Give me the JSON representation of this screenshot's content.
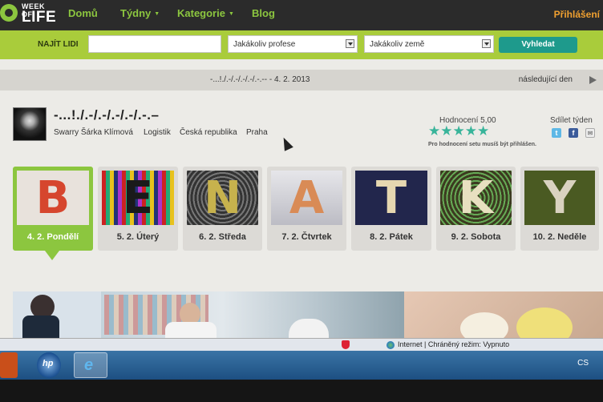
{
  "nav": {
    "logo_small": "WEEK OF",
    "logo_big": "LIFE",
    "items": [
      {
        "label": "Domů",
        "has_dropdown": false
      },
      {
        "label": "Týdny",
        "has_dropdown": true
      },
      {
        "label": "Kategorie",
        "has_dropdown": true
      },
      {
        "label": "Blog",
        "has_dropdown": false
      }
    ],
    "dropdown_caret": "▼",
    "login": "Přihlášení"
  },
  "search": {
    "label": "NAJÍT LIDI",
    "input_value": "",
    "profession_select": "Jakákoliv profese",
    "country_select": "Jakákoliv země",
    "button": "Vyhledat"
  },
  "week": {
    "date_line": "-...!./.-/.-/.-/.-/.-.-- - 4. 2. 2013",
    "next_day": "následující den"
  },
  "profile": {
    "title": "-...!./.-/.-/.-/.-/.-.–",
    "name": "Swarry Šárka Klímová",
    "profession": "Logistik",
    "country": "Česká republika",
    "city": "Praha",
    "rating_label": "Hodnocení 5,00",
    "rating_value": 5,
    "rating_max": 5,
    "rating_note": "Pro hodnocení setu musíš být přihlášen.",
    "share_label": "Sdílet týden",
    "share_icons": [
      "twitter-icon",
      "facebook-icon",
      "email-icon"
    ],
    "accent_color": "#38b49a"
  },
  "days": [
    {
      "label": "4. 2. Pondělí",
      "letter": "B",
      "active": true
    },
    {
      "label": "5. 2. Úterý",
      "letter": "E",
      "active": false
    },
    {
      "label": "6. 2. Středa",
      "letter": "N",
      "active": false
    },
    {
      "label": "7. 2. Čtvrtek",
      "letter": "A",
      "active": false
    },
    {
      "label": "8. 2. Pátek",
      "letter": "T",
      "active": false
    },
    {
      "label": "9. 2. Sobota",
      "letter": "K",
      "active": false
    },
    {
      "label": "10. 2. Neděle",
      "letter": "Y",
      "active": false
    }
  ],
  "browser": {
    "status": "Internet | Chráněný režim: Vypnuto",
    "language": "CS"
  },
  "colors": {
    "brand_green": "#8cc63f",
    "search_bar": "#a9cc3b",
    "search_button": "#1e9a8c",
    "login": "#f0a030"
  }
}
